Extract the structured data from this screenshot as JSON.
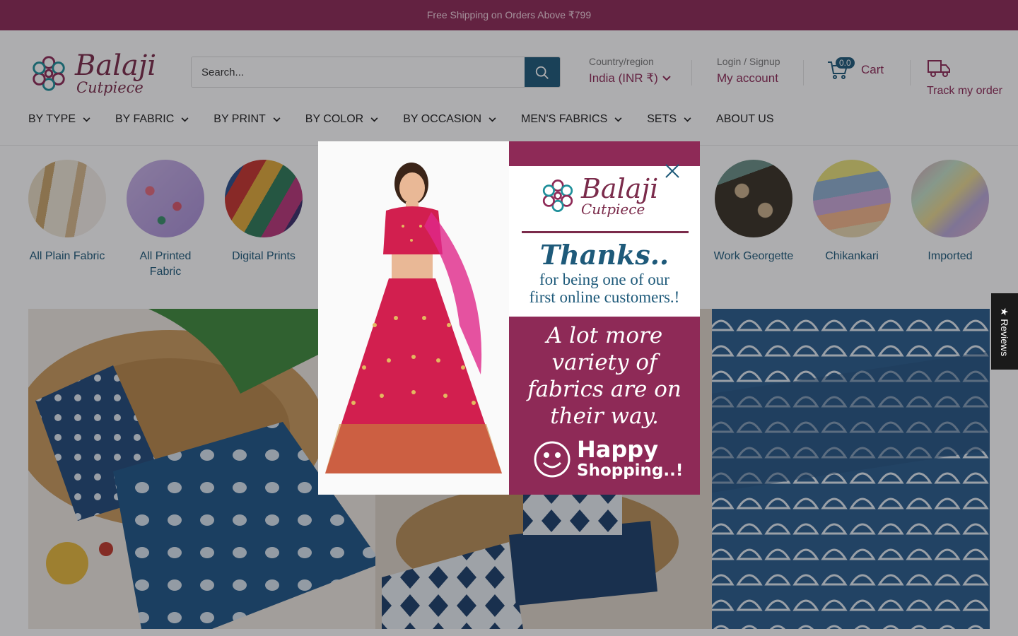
{
  "announcement": "Free Shipping on Orders Above ₹799",
  "logo": {
    "line1": "Balaji",
    "line2": "Cutpiece"
  },
  "search": {
    "placeholder": "Search..."
  },
  "region": {
    "label": "Country/region",
    "value": "India (INR ₹)"
  },
  "account": {
    "label": "Login / Signup",
    "value": "My account"
  },
  "cart": {
    "count": "0.0",
    "label": "Cart"
  },
  "track": {
    "label": "Track my order"
  },
  "nav": [
    {
      "label": "BY TYPE"
    },
    {
      "label": "BY FABRIC"
    },
    {
      "label": "BY PRINT"
    },
    {
      "label": "BY COLOR"
    },
    {
      "label": "BY OCCASION"
    },
    {
      "label": "MEN'S FABRICS"
    },
    {
      "label": "SETS"
    },
    {
      "label": "ABOUT US"
    }
  ],
  "collections": [
    {
      "name": "All Plain Fabric"
    },
    {
      "name": "All Printed Fabric"
    },
    {
      "name": "Digital Prints"
    },
    {
      "name": "Work Georgette"
    },
    {
      "name": "Chikankari"
    },
    {
      "name": "Imported"
    }
  ],
  "popup": {
    "logo_line1": "Balaji",
    "logo_line2": "Cutpiece",
    "thanks": "Thanks..",
    "thanks_sub_1": "for being one of our",
    "thanks_sub_2": "first online customers.!",
    "variety_1": "A lot more",
    "variety_2": "variety of",
    "variety_3": "fabrics are on",
    "variety_4": "their way.",
    "happy_1": "Happy",
    "happy_2": "Shopping..!"
  },
  "reviews_tab": "★ Reviews",
  "colors": {
    "brand": "#8e2a57",
    "accent": "#1e5a7a"
  }
}
